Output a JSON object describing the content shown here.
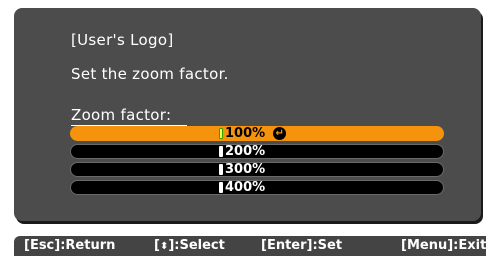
{
  "dialog": {
    "title": "[User's Logo]",
    "prompt": "Set the zoom factor.",
    "zoom_label": "Zoom factor:",
    "options": [
      {
        "label": "100%",
        "selected": true
      },
      {
        "label": "200%",
        "selected": false
      },
      {
        "label": "300%",
        "selected": false
      },
      {
        "label": "400%",
        "selected": false
      }
    ],
    "enter_icon_glyph": "↵"
  },
  "footer": {
    "esc": "[Esc]:Return",
    "select_prefix": "[",
    "select_icon": "⬍",
    "select_suffix": "]:Select",
    "enter": "[Enter]:Set",
    "menu": "[Menu]:Exit"
  },
  "colors": {
    "panel": "#4c4c4c",
    "highlight": "#f5940c",
    "footer": "#444444"
  }
}
